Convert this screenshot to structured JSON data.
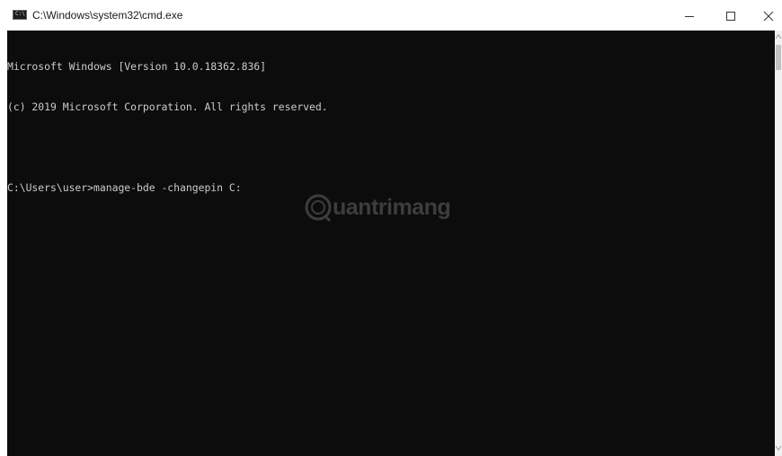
{
  "window": {
    "title": "C:\\Windows\\system32\\cmd.exe",
    "icon": "cmd-icon",
    "icon_glyph": "C:\\"
  },
  "controls": {
    "minimize_icon": "minimize-icon",
    "maximize_icon": "maximize-icon",
    "close_icon": "close-icon"
  },
  "console": {
    "lines": [
      "Microsoft Windows [Version 10.0.18362.836]",
      "(c) 2019 Microsoft Corporation. All rights reserved.",
      "",
      "C:\\Users\\user>manage-bde -changepin C:"
    ],
    "background": "#0c0c0c",
    "foreground": "#cccccc"
  },
  "watermark": {
    "text": "uantrimang"
  }
}
